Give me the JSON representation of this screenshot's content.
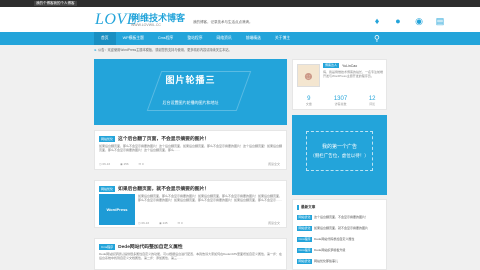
{
  "topbar": {
    "text": "我的个博客我的个人博客"
  },
  "header": {
    "logo_main": "LOVE",
    "logo_cn": "俐维技术博客",
    "logo_sub": "WWW.LOVWIL.CC",
    "slogan": "我的博客，记录技术与生活点点滴滴。",
    "icons": [
      "bell-icon",
      "qq-icon",
      "weibo-icon",
      "rss-icon"
    ]
  },
  "nav": {
    "items": [
      "首页",
      "WP模板主题",
      "Cms程序",
      "整站程序",
      "网络资讯",
      "前端精选",
      "关于博主"
    ],
    "active_index": 0
  },
  "notice": {
    "text": "公告：欢迎使用WordPress主题本模板，感谢您的支持与使用，更多精彩内容请持续关注本站。"
  },
  "slider": {
    "title": "图片轮播三",
    "subtitle": "后台设置图片轮播的图片和地址"
  },
  "posts": [
    {
      "tag": "网站优化",
      "title": "这个后台翻了页面，不会显示摘要的图片！",
      "body": "如果后台翻页面，那么不会显示摘要的图片！这个后台翻页面，如果后台翻页面，那么不会显示摘要的图片！这个后台翻页面！如果后台翻页面，那么不会显示摘要的图片！这个后台翻页面，那么……",
      "date": "06-16",
      "views": "256",
      "comments": "0",
      "more": "阅读全文"
    },
    {
      "tag": "网站优化",
      "title": "如果后台翻页面，就不会显示摘要的图片！",
      "thumb": "WordPress",
      "body": "如果后台翻页面，那么不会显示摘要的图片！如果后台翻页面，那么不会显示摘要的图片！如果后台翻页面，那么不会显示摘要的图片！如果后台翻页面，那么不会显示摘要的图片！如果后台翻页面，那么不会显示……",
      "date": "06-16",
      "views": "245",
      "comments": "0",
      "more": "阅读全文"
    },
    {
      "tag": "Cms程序",
      "title": "Dede网站代码整加自定义属性",
      "body": "Dede网站织梦默认提供很多属性自定义的功能，可以根据后台进行配置，本篇告诉大家如何在DedeCMS里面增加自定义属性，第一步：在后台系统中找到自定义文档属性，第二步：添加属性，第三……",
      "date": "06-15",
      "views": "244",
      "comments": "0",
      "more": "阅读全文"
    }
  ],
  "profile": {
    "badge": "博客达人",
    "name": "YuLinCao",
    "desc": "嗨，我是俐维技术博客的站长，一名专注前端开发与WordPress主题开发的程序员。",
    "stats": [
      {
        "num": "9",
        "label": "文章"
      },
      {
        "num": "1307",
        "label": "访客总数"
      },
      {
        "num": "12",
        "label": "评论"
      }
    ]
  },
  "ad": {
    "line1": "我的第一个广告",
    "line2": "（侧栏广告位，虚位以待！）"
  },
  "latest": {
    "title": "最新文章",
    "items": [
      {
        "tag": "网站优化",
        "text": "这个后台翻页面，不会显示摘要的图片！"
      },
      {
        "tag": "网站优化",
        "text": "如果后台翻页面，就不会显示摘要的图片"
      },
      {
        "tag": "Cms程序",
        "text": "Dede网站代码整加自定义属性"
      },
      {
        "tag": "Cms程序",
        "text": "Dede网站织梦模板升级"
      },
      {
        "tag": "网站优化",
        "text": "网站优化那些事儿"
      }
    ]
  }
}
